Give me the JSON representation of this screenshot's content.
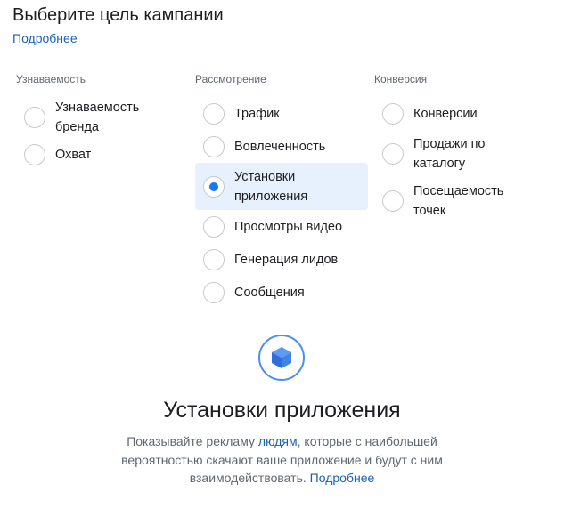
{
  "header": {
    "title": "Выберите цель кампании",
    "learn_more": "Подробнее"
  },
  "columns": [
    {
      "heading": "Узнаваемость",
      "options": [
        {
          "label": "Узнаваемость бренда",
          "selected": false
        },
        {
          "label": "Охват",
          "selected": false
        }
      ]
    },
    {
      "heading": "Рассмотрение",
      "options": [
        {
          "label": "Трафик",
          "selected": false
        },
        {
          "label": "Вовлеченность",
          "selected": false
        },
        {
          "label": "Установки приложения",
          "selected": true
        },
        {
          "label": "Просмотры видео",
          "selected": false
        },
        {
          "label": "Генерация лидов",
          "selected": false
        },
        {
          "label": "Сообщения",
          "selected": false
        }
      ]
    },
    {
      "heading": "Конверсия",
      "options": [
        {
          "label": "Конверсии",
          "selected": false
        },
        {
          "label": "Продажи по каталогу",
          "selected": false
        },
        {
          "label": "Посещаемость точек",
          "selected": false
        }
      ]
    }
  ],
  "detail": {
    "icon": "cube-icon",
    "title": "Установки приложения",
    "desc_before": "Показывайте рекламу ",
    "desc_link": "людям",
    "desc_after": ", которые с наибольшей вероятностью скачают ваше приложение и будут с ним взаимодействовать. ",
    "learn_more": "Подробнее"
  },
  "colors": {
    "accent": "#1877f2",
    "link": "#1a5fb4",
    "selected_bg": "#e7f1fd",
    "icon_ring": "#4a8ef0"
  }
}
